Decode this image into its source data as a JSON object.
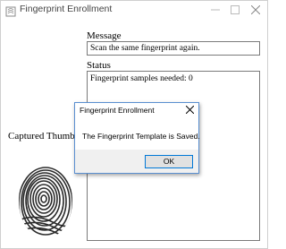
{
  "window": {
    "title": "Fingerprint Enrollment"
  },
  "labels": {
    "message": "Message",
    "status": "Status",
    "captured_thumb": "Captured Thumb"
  },
  "message_value": "Scan the same fingerprint again.",
  "status_lines": [
    "Fingerprint samples needed: 0"
  ],
  "dialog": {
    "title": "Fingerprint Enrollment",
    "text": "The Fingerprint Template is Saved.",
    "ok_label": "OK"
  },
  "colors": {
    "dialog_border": "#5a8fd0",
    "ok_border": "#0078d7",
    "footer_bg": "#f0f0f0"
  }
}
